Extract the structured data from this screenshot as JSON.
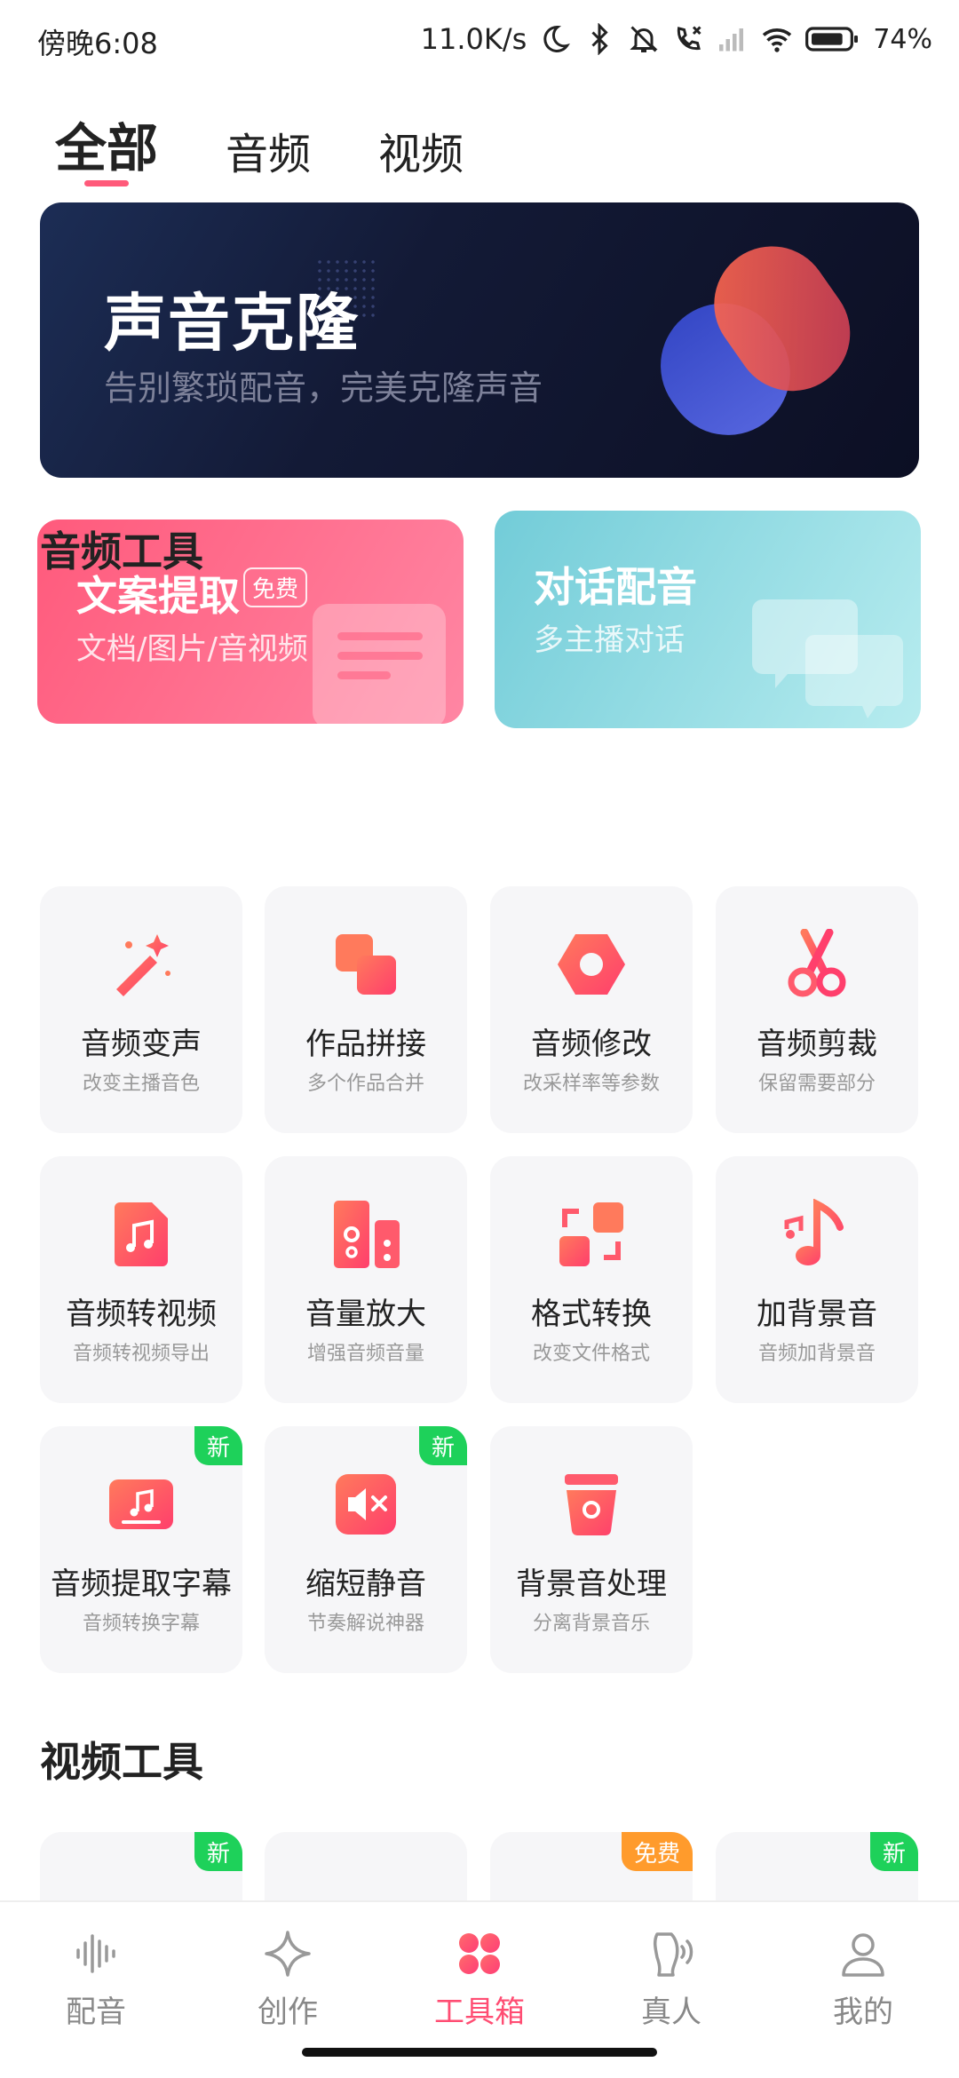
{
  "status_bar": {
    "time": "傍晚6:08",
    "net_speed": "11.0K/s",
    "battery": "74%"
  },
  "tabs": [
    {
      "label": "全部",
      "active": true
    },
    {
      "label": "音频",
      "active": false
    },
    {
      "label": "视频",
      "active": false
    }
  ],
  "hero": {
    "title": "声音克隆",
    "subtitle": "告别繁琐配音，完美克隆声音"
  },
  "features": [
    {
      "title": "文案提取",
      "badge": "免费",
      "subtitle": "文档/图片/音视频"
    },
    {
      "title": "对话配音",
      "subtitle": "多主播对话"
    }
  ],
  "audio_section": {
    "title": "音频工具",
    "tools": [
      {
        "label": "音频变声",
        "desc": "改变主播音色",
        "icon": "magic-wand-icon"
      },
      {
        "label": "作品拼接",
        "desc": "多个作品合并",
        "icon": "merge-icon"
      },
      {
        "label": "音频修改",
        "desc": "改采样率等参数",
        "icon": "hex-settings-icon"
      },
      {
        "label": "音频剪裁",
        "desc": "保留需要部分",
        "icon": "scissors-icon"
      },
      {
        "label": "音频转视频",
        "desc": "音频转视频导出",
        "icon": "music-file-icon"
      },
      {
        "label": "音量放大",
        "desc": "增强音频音量",
        "icon": "speaker-icon"
      },
      {
        "label": "格式转换",
        "desc": "改变文件格式",
        "icon": "convert-icon"
      },
      {
        "label": "加背景音",
        "desc": "音频加背景音",
        "icon": "music-note-icon"
      },
      {
        "label": "音频提取字幕",
        "desc": "音频转换字幕",
        "icon": "subtitle-icon",
        "badge": "新"
      },
      {
        "label": "缩短静音",
        "desc": "节奏解说神器",
        "icon": "mute-icon",
        "badge": "新"
      },
      {
        "label": "背景音处理",
        "desc": "分离背景音乐",
        "icon": "bucket-icon"
      }
    ]
  },
  "video_section": {
    "title": "视频工具",
    "badges": [
      "新",
      "免费",
      "新"
    ]
  },
  "bottom_nav": [
    {
      "label": "配音",
      "icon": "waveform-icon",
      "active": false
    },
    {
      "label": "创作",
      "icon": "sparkle-icon",
      "active": false
    },
    {
      "label": "工具箱",
      "icon": "grid-dots-icon",
      "active": true
    },
    {
      "label": "真人",
      "icon": "voice-person-icon",
      "active": false
    },
    {
      "label": "我的",
      "icon": "user-icon",
      "active": false
    }
  ],
  "colors": {
    "accent": "#ff4d73",
    "new_badge": "#1ed15a",
    "free_badge": "#ff9b2c",
    "hero_bg": "#131a36"
  }
}
